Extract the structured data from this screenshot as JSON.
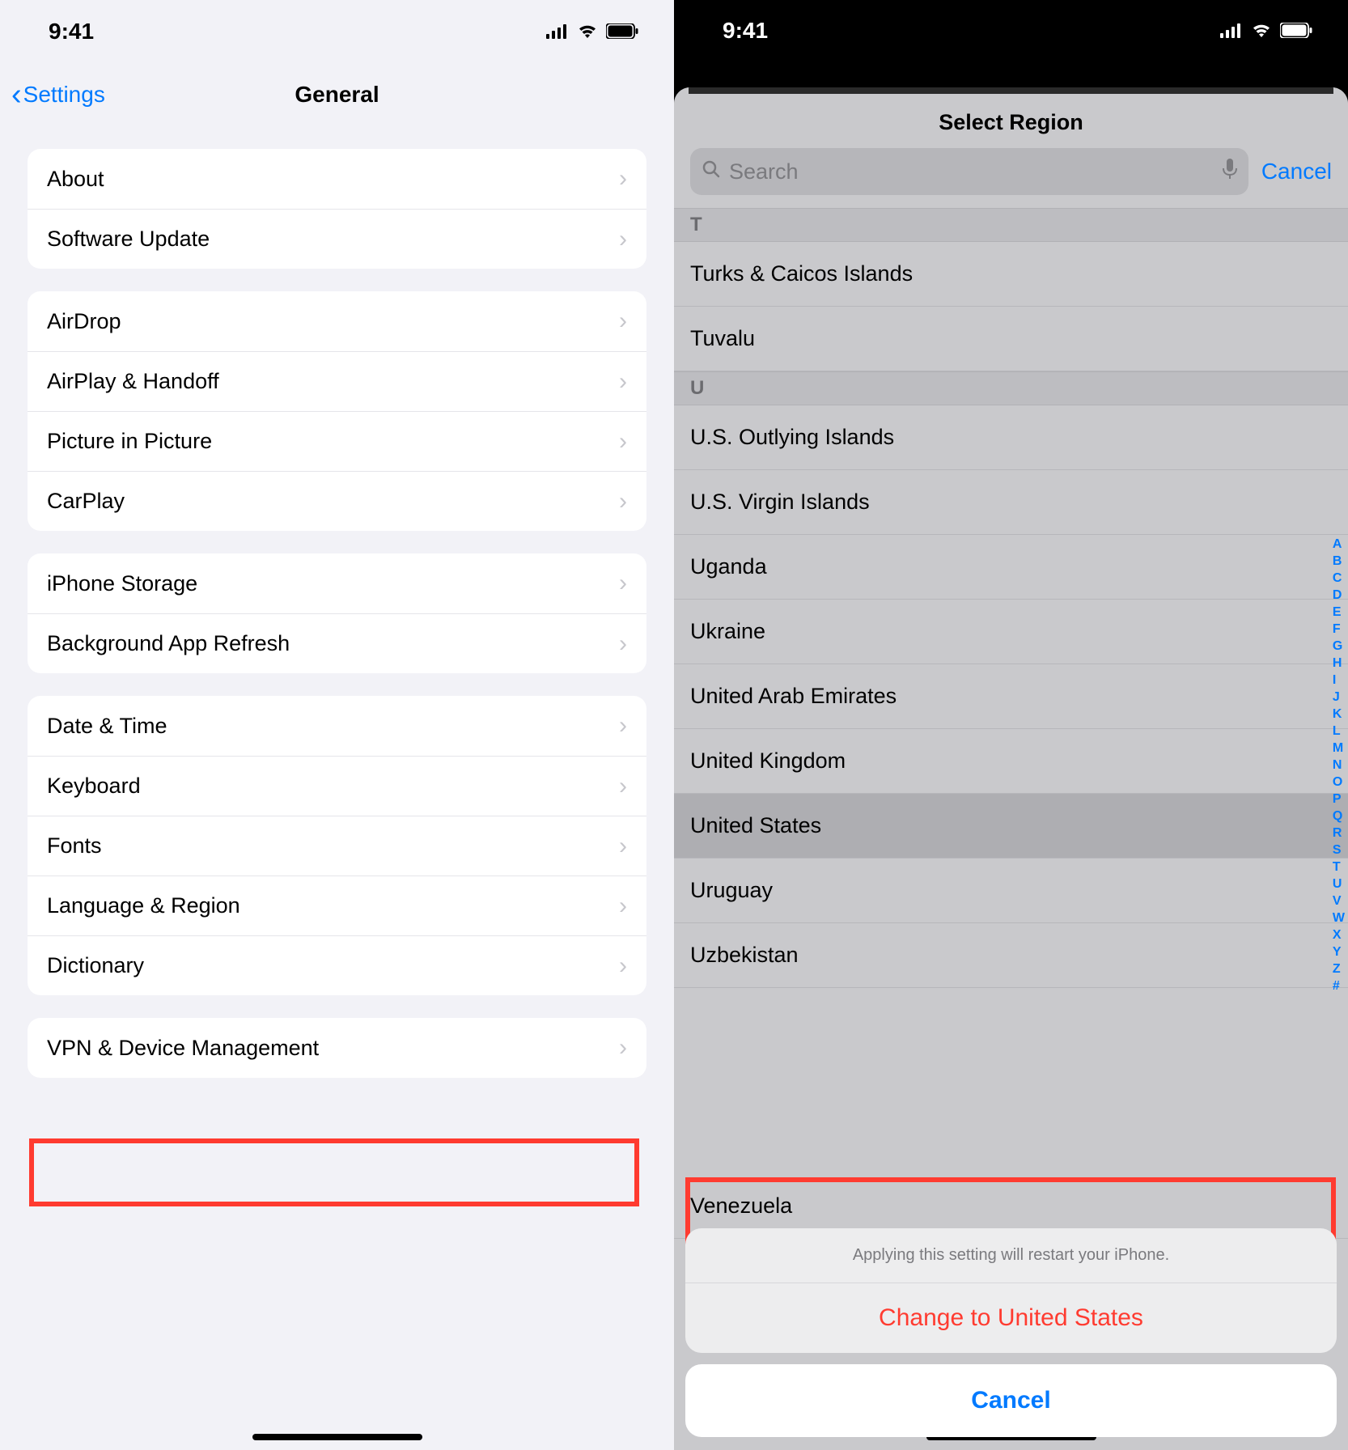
{
  "status": {
    "time": "9:41"
  },
  "left": {
    "back_label": "Settings",
    "title": "General",
    "group1": [
      "About",
      "Software Update"
    ],
    "group2": [
      "AirDrop",
      "AirPlay & Handoff",
      "Picture in Picture",
      "CarPlay"
    ],
    "group3": [
      "iPhone Storage",
      "Background App Refresh"
    ],
    "group4": [
      "Date & Time",
      "Keyboard",
      "Fonts",
      "Language & Region",
      "Dictionary"
    ],
    "group5": [
      "VPN & Device Management"
    ]
  },
  "right": {
    "title": "Select Region",
    "search_placeholder": "Search",
    "cancel": "Cancel",
    "section_T": "T",
    "section_U": "U",
    "regions_T": [
      "Turks & Caicos Islands",
      "Tuvalu"
    ],
    "regions_U": [
      "U.S. Outlying Islands",
      "U.S. Virgin Islands",
      "Uganda",
      "Ukraine",
      "United Arab Emirates",
      "United Kingdom",
      "United States",
      "Uruguay",
      "Uzbekistan"
    ],
    "region_tail": "Venezuela",
    "index_letters": [
      "A",
      "B",
      "C",
      "D",
      "E",
      "F",
      "G",
      "H",
      "I",
      "J",
      "K",
      "L",
      "M",
      "N",
      "O",
      "P",
      "Q",
      "R",
      "S",
      "T",
      "U",
      "V",
      "W",
      "X",
      "Y",
      "Z",
      "#"
    ],
    "sheet_msg": "Applying this setting will restart your iPhone.",
    "sheet_change": "Change to United States",
    "sheet_cancel": "Cancel"
  }
}
